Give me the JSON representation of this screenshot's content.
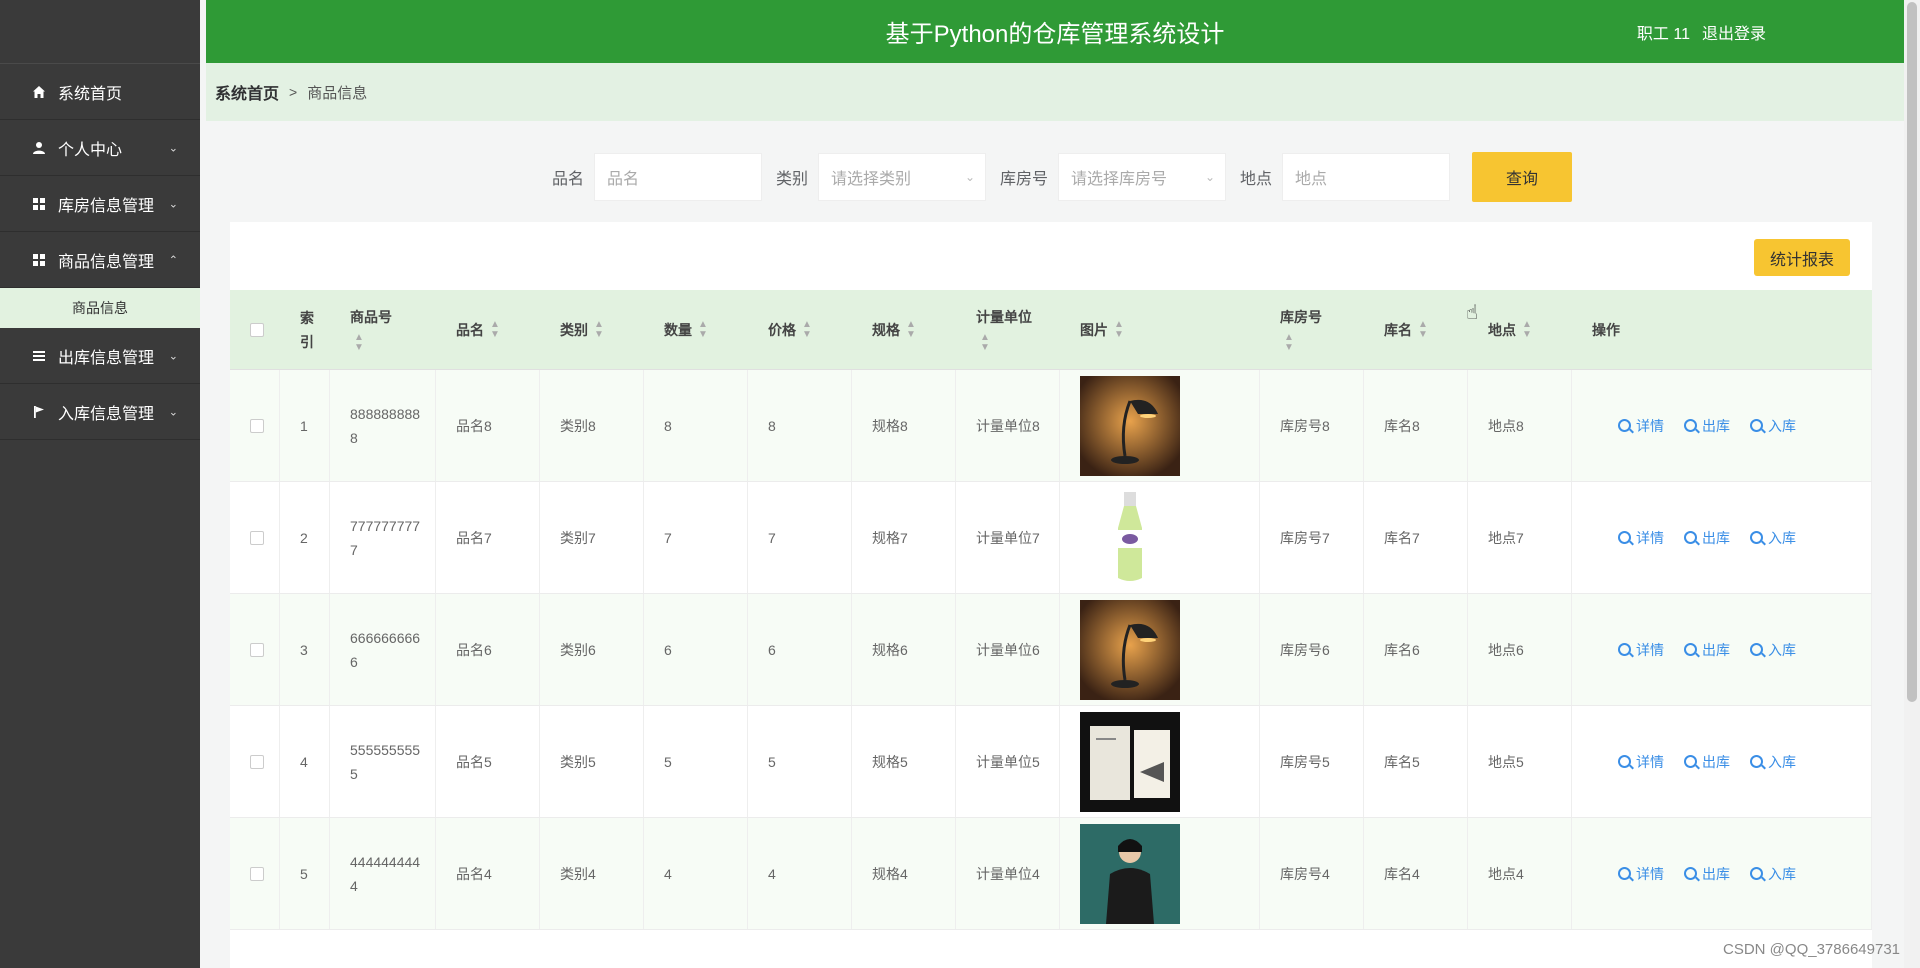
{
  "sidebar": {
    "items": [
      {
        "label": "系统首页",
        "icon": "home-icon"
      },
      {
        "label": "个人中心",
        "icon": "user-icon"
      },
      {
        "label": "库房信息管理",
        "icon": "grid-icon"
      },
      {
        "label": "商品信息管理",
        "icon": "grid-icon"
      },
      {
        "label": "出库信息管理",
        "icon": "list-icon"
      },
      {
        "label": "入库信息管理",
        "icon": "flag-icon"
      }
    ],
    "submenu": {
      "label": "商品信息"
    }
  },
  "header": {
    "title": "基于Python的仓库管理系统设计",
    "user": "职工 11",
    "logout": "退出登录"
  },
  "breadcrumb": {
    "home": "系统首页",
    "sep": ">",
    "current": "商品信息"
  },
  "search": {
    "name_label": "品名",
    "name_placeholder": "品名",
    "category_label": "类别",
    "category_placeholder": "请选择类别",
    "room_label": "库房号",
    "room_placeholder": "请选择库房号",
    "location_label": "地点",
    "location_placeholder": "地点",
    "query_button": "查询"
  },
  "toolbar": {
    "report_button": "统计报表"
  },
  "table": {
    "headers": {
      "index": "索引",
      "code": "商品号",
      "name": "品名",
      "category": "类别",
      "qty": "数量",
      "price": "价格",
      "spec": "规格",
      "unit": "计量单位",
      "image": "图片",
      "room": "库房号",
      "store": "库名",
      "location": "地点",
      "actions": "操作"
    },
    "actions": {
      "detail": "详情",
      "out": "出库",
      "in": "入库"
    },
    "rows": [
      {
        "index": "1",
        "code": "8888888888",
        "name": "品名8",
        "category": "类别8",
        "qty": "8",
        "price": "8",
        "spec": "规格8",
        "unit": "计量单位8",
        "room": "库房号8",
        "store": "库名8",
        "location": "地点8",
        "image": "lamp"
      },
      {
        "index": "2",
        "code": "7777777777",
        "name": "品名7",
        "category": "类别7",
        "qty": "7",
        "price": "7",
        "spec": "规格7",
        "unit": "计量单位7",
        "room": "库房号7",
        "store": "库名7",
        "location": "地点7",
        "image": "bottle"
      },
      {
        "index": "3",
        "code": "6666666666",
        "name": "品名6",
        "category": "类别6",
        "qty": "6",
        "price": "6",
        "spec": "规格6",
        "unit": "计量单位6",
        "room": "库房号6",
        "store": "库名6",
        "location": "地点6",
        "image": "lamp"
      },
      {
        "index": "4",
        "code": "5555555555",
        "name": "品名5",
        "category": "类别5",
        "qty": "5",
        "price": "5",
        "spec": "规格5",
        "unit": "计量单位5",
        "room": "库房号5",
        "store": "库名5",
        "location": "地点5",
        "image": "book"
      },
      {
        "index": "5",
        "code": "4444444444",
        "name": "品名4",
        "category": "类别4",
        "qty": "4",
        "price": "4",
        "spec": "规格4",
        "unit": "计量单位4",
        "room": "库房号4",
        "store": "库名4",
        "location": "地点4",
        "image": "person"
      }
    ]
  },
  "watermark": "CSDN @QQ_3786649731"
}
